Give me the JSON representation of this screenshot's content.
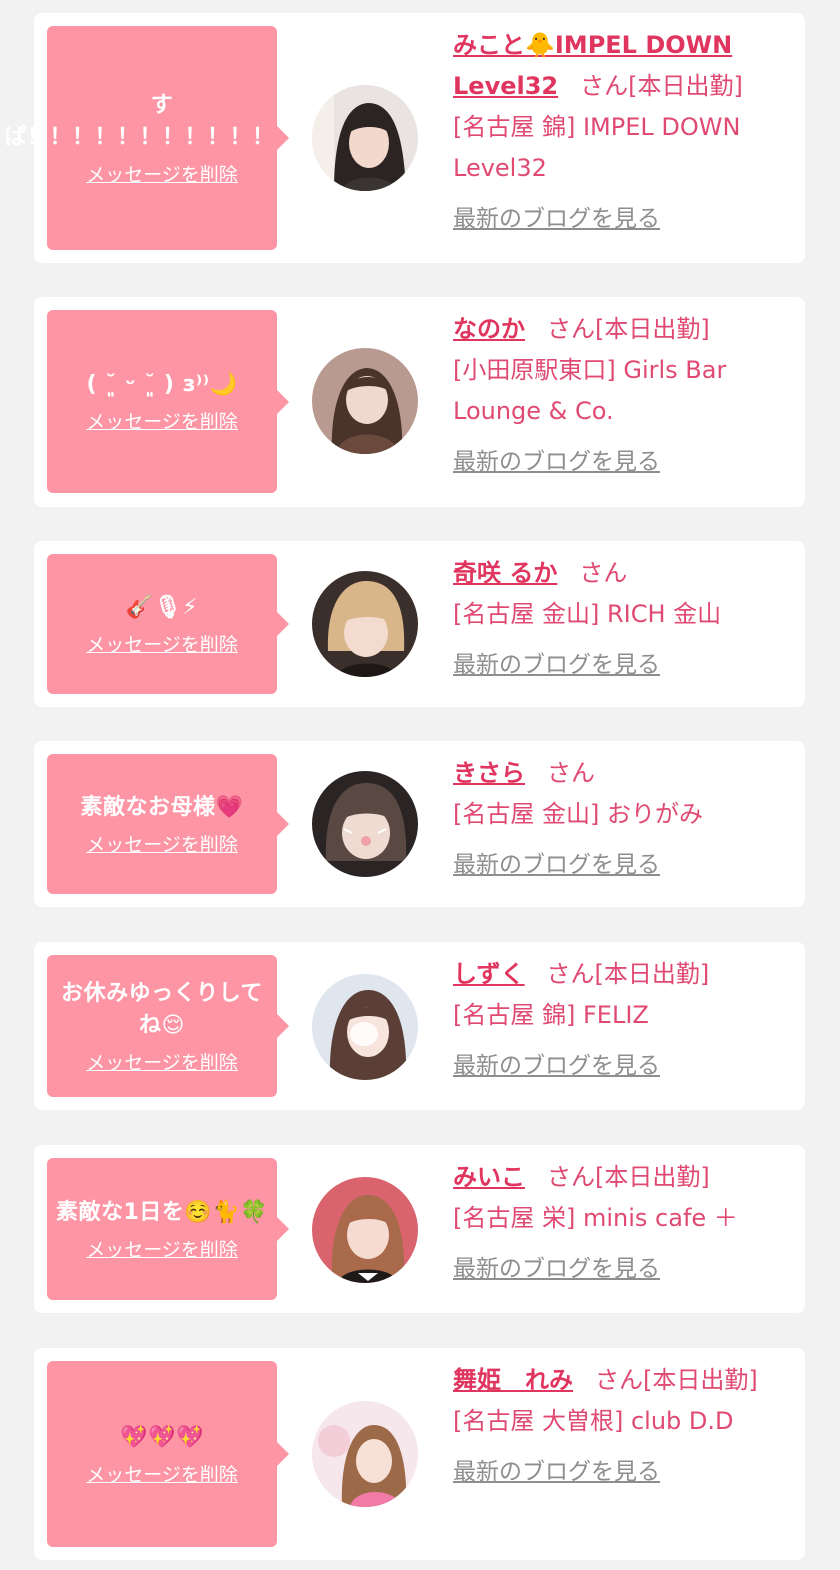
{
  "colors": {
    "page_bg": "#f2f2f2",
    "card_bg": "#ffffff",
    "bubble_bg": "#fd95a5",
    "name_color": "#e0355f",
    "text_pink": "#e04a72",
    "link_gray": "#8e8e8e"
  },
  "items": [
    {
      "message": "すぱ！！！！！！！！！！！！！",
      "delete_label": "メッセージを削除",
      "name": "みこと🐥IMPEL DOWN Level32",
      "san": "さん",
      "status": "[本日出勤]",
      "shop": "[名古屋 錦] IMPEL DOWN Level32",
      "blog_label": "最新のブログを見る",
      "avatar_icon": "avatar-photo"
    },
    {
      "message": "( ˘͈ ᵕ ˘͈ ) з⁾⁾🌙",
      "delete_label": "メッセージを削除",
      "name": "なのか",
      "san": "さん",
      "status": "[本日出勤]",
      "shop": "[小田原駅東口] Girls Bar Lounge & Co.",
      "blog_label": "最新のブログを見る",
      "avatar_icon": "avatar-photo"
    },
    {
      "message": "🎸🎙⚡",
      "delete_label": "メッセージを削除",
      "name": "奇咲 るか",
      "san": "さん",
      "status": "",
      "shop": "[名古屋 金山] RICH 金山",
      "blog_label": "最新のブログを見る",
      "avatar_icon": "avatar-photo"
    },
    {
      "message": "素敵なお母様💗",
      "delete_label": "メッセージを削除",
      "name": "きさら",
      "san": "さん",
      "status": "",
      "shop": "[名古屋 金山] おりがみ",
      "blog_label": "最新のブログを見る",
      "avatar_icon": "avatar-photo"
    },
    {
      "message": "お休みゆっくりしてね😌",
      "delete_label": "メッセージを削除",
      "name": "しずく",
      "san": "さん",
      "status": "[本日出勤]",
      "shop": "[名古屋 錦] FELIZ",
      "blog_label": "最新のブログを見る",
      "avatar_icon": "avatar-photo"
    },
    {
      "message": "素敵な1日を☺️🐈🍀",
      "delete_label": "メッセージを削除",
      "name": "みいこ",
      "san": "さん",
      "status": "[本日出勤]",
      "shop": "[名古屋 栄] minis cafe ＋",
      "blog_label": "最新のブログを見る",
      "avatar_icon": "avatar-photo"
    },
    {
      "message": "💖💖💖",
      "delete_label": "メッセージを削除",
      "name": "舞姫　れみ",
      "san": "さん",
      "status": "[本日出勤]",
      "shop": "[名古屋 大曽根] club D.D",
      "blog_label": "最新のブログを見る",
      "avatar_icon": "avatar-photo"
    }
  ]
}
